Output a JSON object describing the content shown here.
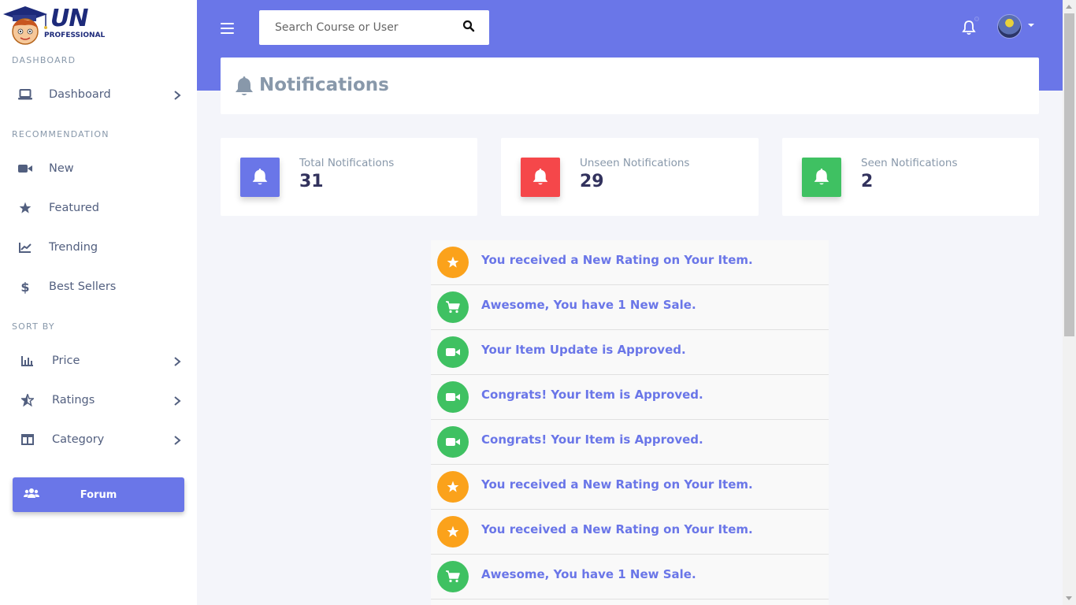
{
  "brand": {
    "logo_big": "UN",
    "logo_small": "PROFESSIONAL"
  },
  "sidebar": {
    "sections": [
      {
        "heading": "DASHBOARD"
      },
      {
        "heading": "RECOMMENDATION"
      },
      {
        "heading": "SORT BY"
      }
    ],
    "dashboard": {
      "label": "Dashboard",
      "icon": "laptop-icon"
    },
    "recommendation": [
      {
        "label": "New",
        "icon": "video-icon"
      },
      {
        "label": "Featured",
        "icon": "star-icon"
      },
      {
        "label": "Trending",
        "icon": "chart-line-icon"
      },
      {
        "label": "Best Sellers",
        "icon": "dollar-icon"
      }
    ],
    "sort_by": [
      {
        "label": "Price",
        "icon": "bar-chart-icon"
      },
      {
        "label": "Ratings",
        "icon": "star-half-icon"
      },
      {
        "label": "Category",
        "icon": "columns-icon"
      }
    ],
    "forum": {
      "label": "Forum",
      "icon": "users-icon"
    }
  },
  "header": {
    "search_placeholder": "Search Course or User"
  },
  "page": {
    "title": "Notifications"
  },
  "stats": [
    {
      "label": "Total Notifications",
      "value": "31",
      "color": "#6a76e8"
    },
    {
      "label": "Unseen Notifications",
      "value": "29",
      "color": "#f5474a"
    },
    {
      "label": "Seen Notifications",
      "value": "2",
      "color": "#3fc162"
    }
  ],
  "notifications": [
    {
      "text": "You received a New Rating on Your Item.",
      "type": "rating",
      "color": "#fba21b",
      "icon": "star-icon"
    },
    {
      "text": "Awesome, You have 1 New Sale.",
      "type": "sale",
      "color": "#3fc162",
      "icon": "cart-icon"
    },
    {
      "text": "Your Item Update is Approved.",
      "type": "approved",
      "color": "#3fc162",
      "icon": "video-icon"
    },
    {
      "text": "Congrats! Your Item is Approved.",
      "type": "approved",
      "color": "#3fc162",
      "icon": "video-icon"
    },
    {
      "text": "Congrats! Your Item is Approved.",
      "type": "approved",
      "color": "#3fc162",
      "icon": "video-icon"
    },
    {
      "text": "You received a New Rating on Your Item.",
      "type": "rating",
      "color": "#fba21b",
      "icon": "star-icon"
    },
    {
      "text": "You received a New Rating on Your Item.",
      "type": "rating",
      "color": "#fba21b",
      "icon": "star-icon"
    },
    {
      "text": "Awesome, You have 1 New Sale.",
      "type": "sale",
      "color": "#3fc162",
      "icon": "cart-icon"
    }
  ],
  "colors": {
    "primary": "#6a76e8",
    "danger": "#f5474a",
    "success": "#3fc162",
    "warning": "#fba21b"
  }
}
